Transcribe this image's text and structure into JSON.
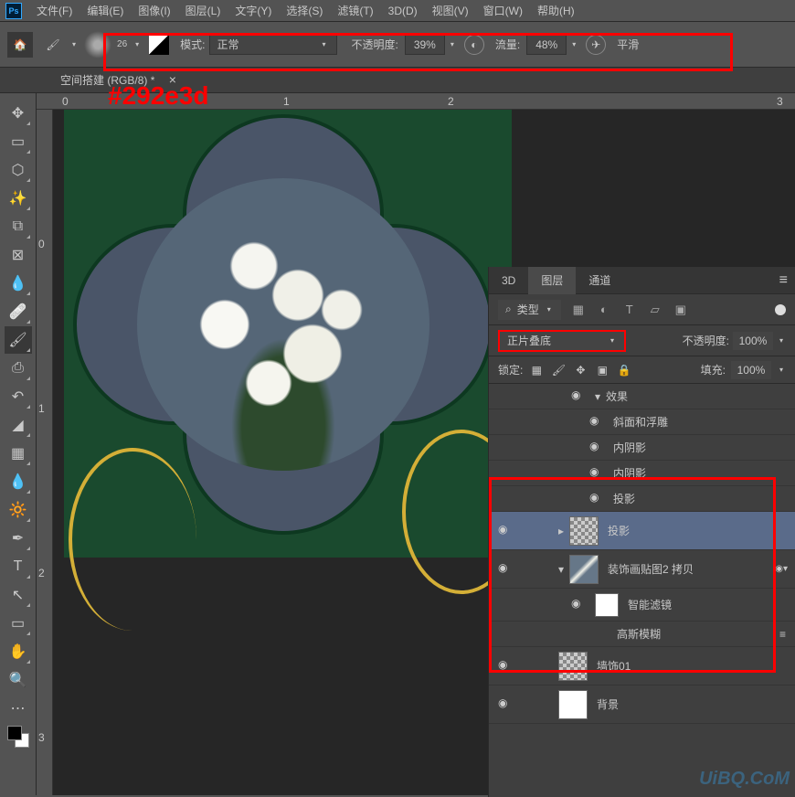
{
  "menu": {
    "items": [
      "文件(F)",
      "编辑(E)",
      "图像(I)",
      "图层(L)",
      "文字(Y)",
      "选择(S)",
      "滤镜(T)",
      "3D(D)",
      "视图(V)",
      "窗口(W)",
      "帮助(H)"
    ]
  },
  "options": {
    "brush_size": "26",
    "mode_label": "模式:",
    "mode_value": "正常",
    "opacity_label": "不透明度:",
    "opacity_value": "39%",
    "flow_label": "流量:",
    "flow_value": "48%",
    "smoothing_label": "平滑"
  },
  "tab": {
    "title": "空间搭建",
    "suffix": "(RGB/8) *"
  },
  "annotation": "#292e3d",
  "ruler_h": [
    "0",
    "1",
    "2",
    "3"
  ],
  "ruler_v": [
    "0",
    "1",
    "2",
    "3"
  ],
  "panel": {
    "tabs": [
      "3D",
      "图层",
      "通道"
    ],
    "kind_label": "类型",
    "blend_mode": "正片叠底",
    "opacity_label": "不透明度:",
    "opacity_value": "100%",
    "lock_label": "锁定:",
    "fill_label": "填充:",
    "fill_value": "100%",
    "effects_group": "效果",
    "effects": [
      "斜面和浮雕",
      "内阴影",
      "内阴影",
      "投影"
    ],
    "layers": [
      {
        "name": "投影",
        "thumb": "checker",
        "indent": 2,
        "sel": true,
        "eye": true
      },
      {
        "name": "装饰画贴图2 拷贝",
        "thumb": "img",
        "indent": 2,
        "eye": true,
        "fx": true
      },
      {
        "name": "智能滤镜",
        "thumb": "white",
        "indent": 4,
        "eye": true,
        "eff": true
      },
      {
        "name": "高斯模糊",
        "indent": 5,
        "eff": true,
        "slider": true
      },
      {
        "name": "墙饰01",
        "thumb": "checker",
        "indent": 2,
        "eye": true,
        "link": true
      },
      {
        "name": "背景",
        "thumb": "white",
        "indent": 2,
        "eye": true,
        "lock": true
      }
    ]
  },
  "watermark": "UiBQ.CoM"
}
